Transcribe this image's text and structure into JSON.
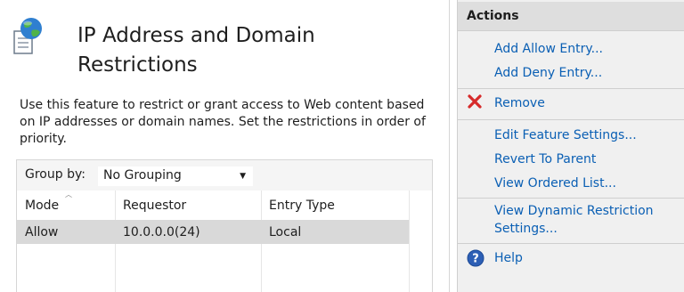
{
  "feature": {
    "title_line1": "IP Address and Domain",
    "title_line2": "Restrictions",
    "description": "Use this feature to restrict or grant access to Web content based on IP addresses or domain names. Set the restrictions in order of priority.",
    "icon": "globe-document-icon"
  },
  "grid": {
    "group_by_label": "Group by:",
    "group_by_value": "No Grouping",
    "columns": [
      "Mode",
      "Requestor",
      "Entry Type"
    ],
    "sorted_column": "Mode",
    "rows": [
      {
        "mode": "Allow",
        "requestor": "10.0.0.0(24)",
        "entry_type": "Local"
      }
    ]
  },
  "actions": {
    "header": "Actions",
    "add_allow": "Add Allow Entry...",
    "add_deny": "Add Deny Entry...",
    "remove": "Remove",
    "edit_feature_settings": "Edit Feature Settings...",
    "revert_to_parent": "Revert To Parent",
    "view_ordered_list": "View Ordered List...",
    "view_dynamic_line1": "View Dynamic Restriction",
    "view_dynamic_line2": "Settings...",
    "help": "Help",
    "link_color": "#0a5fb4",
    "remove_icon_color": "#d62a2a"
  }
}
